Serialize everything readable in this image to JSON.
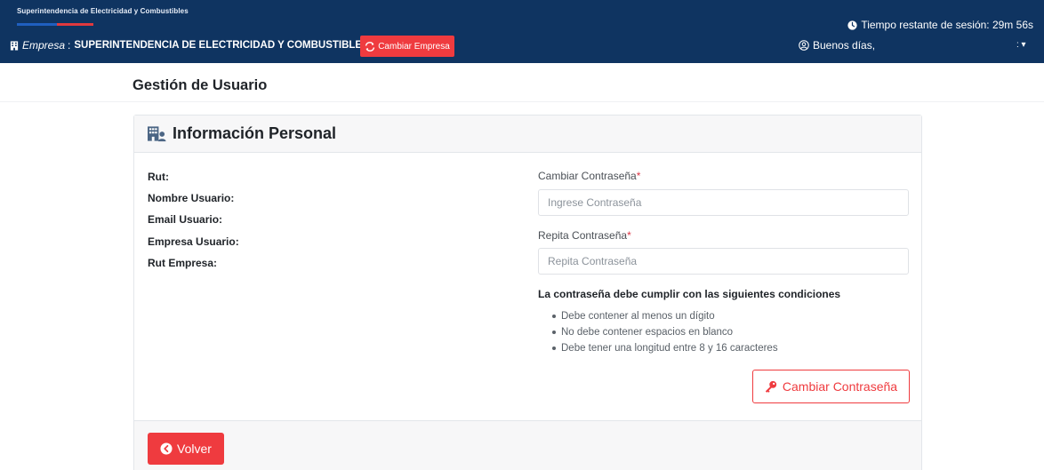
{
  "header": {
    "brand": "Superintendencia de Electricidad y Combustibles",
    "session_text": "Tiempo restante de sesión: 29m 56s",
    "empresa_label": "Empresa",
    "empresa_sep": ":",
    "empresa_name": "SUPERINTENDENCIA DE ELECTRICIDAD Y COMBUSTIBLES",
    "cambiar_empresa_label": "Cambiar Empresa",
    "greeting": "Buenos días,",
    "user_menu": ": ▾",
    "colors": {
      "bar": "#0f3461",
      "accent": "#ef3b3f"
    }
  },
  "page": {
    "title": "Gestión de Usuario"
  },
  "card": {
    "title": "Información Personal",
    "icon": "building-user-icon",
    "info_labels": [
      "Rut:",
      "Nombre Usuario:",
      "Email Usuario:",
      "Empresa Usuario:",
      "Rut Empresa:"
    ],
    "password": {
      "label": "Cambiar Contraseña",
      "required_mark": "*",
      "placeholder": "Ingrese Contraseña",
      "value": ""
    },
    "repeat_password": {
      "label": "Repita Contraseña",
      "required_mark": "*",
      "placeholder": "Repita Contraseña",
      "value": ""
    },
    "conditions_title": "La contraseña debe cumplir con las siguientes condiciones",
    "conditions": [
      "Debe contener al menos un dígito",
      "No debe contener espacios en blanco",
      "Debe tener una longitud entre 8 y 16 caracteres"
    ],
    "change_password_button": "Cambiar Contraseña",
    "back_button": "Volver"
  }
}
